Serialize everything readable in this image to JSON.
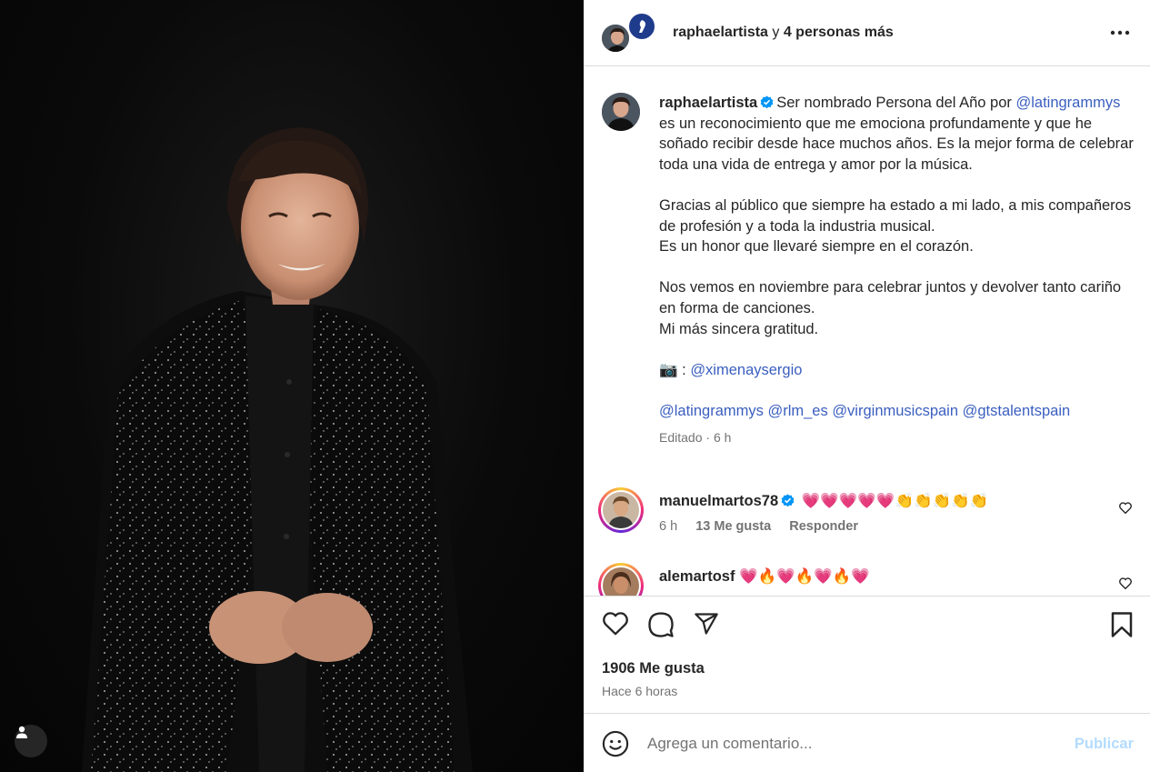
{
  "header": {
    "username": "raphaelartista",
    "connector": " y ",
    "others": "4 personas más"
  },
  "caption": {
    "username": "raphaelartista",
    "p1_start": "Ser nombrado Persona del Año por ",
    "p1_mention": "@latingrammys",
    "p1_end": " es un reconocimiento que me emociona profundamente y que he soñado recibir desde hace muchos años. Es la mejor forma de celebrar toda una vida de entrega y amor por la música.",
    "p2_l1": "Gracias al público que siempre ha estado a mi lado, a mis compañeros de profesión y a toda la industria musical.",
    "p2_l2": "Es un honor que llevaré siempre en el corazón.",
    "p3_l1": "Nos vemos en noviembre para celebrar juntos y devolver tanto cariño en forma de canciones.",
    "p3_l2": "Mi más sincera gratitud.",
    "camera": "📷",
    "camera_sep": " : ",
    "photo_credit": "@ximenaysergio",
    "tags": [
      "@latingrammys",
      "@rlm_es",
      "@virginmusicspain",
      "@gtstalentspain"
    ],
    "edited": "Editado",
    "dot": " · ",
    "age": "6 h"
  },
  "comments": [
    {
      "username": "manuelmartos78",
      "text": "💗💗💗💗💗👏👏👏👏👏",
      "time": "6 h",
      "likes": "13 Me gusta",
      "reply": "Responder"
    },
    {
      "username": "alemartosf",
      "text": "💗🔥💗🔥💗🔥💗"
    }
  ],
  "stats": {
    "likes": "1906 Me gusta",
    "posted": "Hace 6 horas"
  },
  "composer": {
    "placeholder": "Agrega un comentario...",
    "publish": "Publicar"
  },
  "colors": {
    "mention": "#3b5fc0",
    "verified": "#0095f6",
    "publish_disabled": "#b3dbff"
  }
}
